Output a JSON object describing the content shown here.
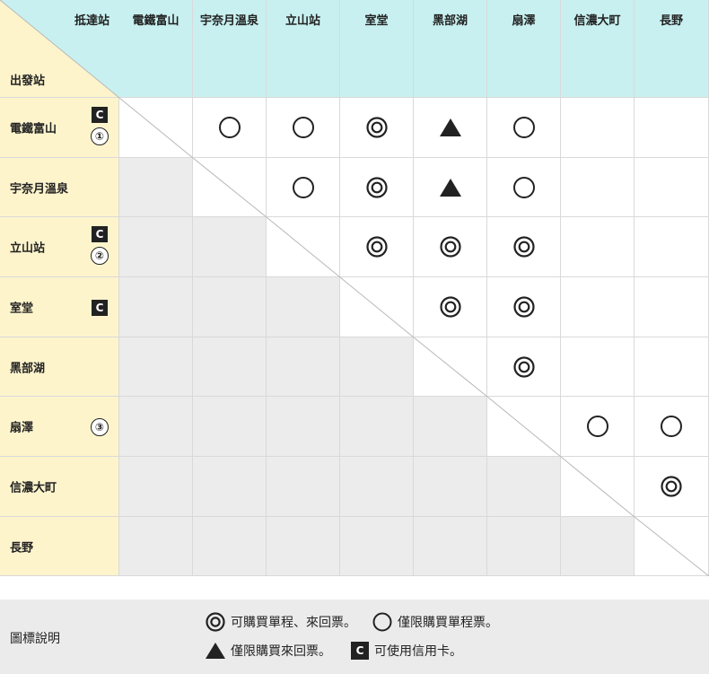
{
  "header": {
    "corner_top": "抵達站",
    "corner_bottom": "出發站",
    "columns": [
      "電鐵富山",
      "宇奈月溫泉",
      "立山站",
      "室堂",
      "黑部湖",
      "扇澤",
      "信濃大町",
      "長野"
    ]
  },
  "rows": [
    {
      "label": "電鐵富山",
      "credit": "C",
      "num": "①"
    },
    {
      "label": "宇奈月溫泉",
      "credit": "",
      "num": ""
    },
    {
      "label": "立山站",
      "credit": "C",
      "num": "②"
    },
    {
      "label": "室堂",
      "credit": "C",
      "num": ""
    },
    {
      "label": "黑部湖",
      "credit": "",
      "num": ""
    },
    {
      "label": "扇澤",
      "credit": "",
      "num": "③"
    },
    {
      "label": "信濃大町",
      "credit": "",
      "num": ""
    },
    {
      "label": "長野",
      "credit": "",
      "num": ""
    }
  ],
  "matrix": [
    [
      "",
      "circle",
      "circle",
      "double",
      "triangle",
      "circle",
      "",
      ""
    ],
    [
      "",
      "",
      "circle",
      "double",
      "triangle",
      "circle",
      "",
      ""
    ],
    [
      "",
      "",
      "",
      "double",
      "double",
      "double",
      "",
      ""
    ],
    [
      "",
      "",
      "",
      "",
      "double",
      "double",
      "",
      ""
    ],
    [
      "",
      "",
      "",
      "",
      "",
      "double",
      "",
      ""
    ],
    [
      "",
      "",
      "",
      "",
      "",
      "",
      "circle",
      "circle"
    ],
    [
      "",
      "",
      "",
      "",
      "",
      "",
      "",
      "double"
    ],
    [
      "",
      "",
      "",
      "",
      "",
      "",
      "",
      ""
    ]
  ],
  "legend": {
    "title": "圖標說明",
    "double_text": "可購買單程、來回票。",
    "circle_text": "僅限購買單程票。",
    "triangle_text": "僅限購買來回票。",
    "credit_symbol": "C",
    "credit_text": "可使用信用卡。"
  },
  "colors": {
    "header_bg": "#c8f0f0",
    "row_header_bg": "#fdf4cc",
    "unavailable_bg": "#ececec",
    "legend_bg": "#ebebeb",
    "symbol": "#222222"
  }
}
